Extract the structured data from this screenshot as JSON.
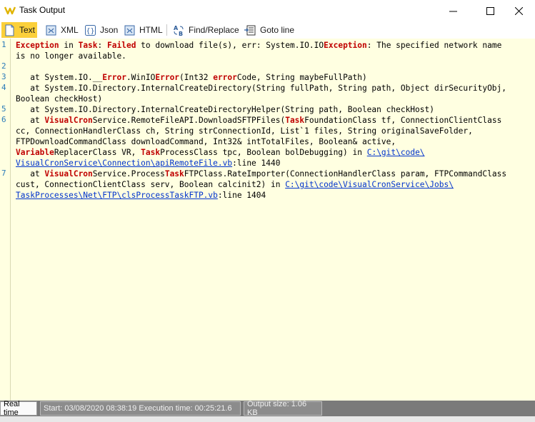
{
  "window": {
    "title": "Task Output",
    "minimize_label": "—",
    "maximize_label": "☐",
    "close_label": "✕"
  },
  "toolbar": {
    "text_label": "Text",
    "xml_label": "XML",
    "json_label": "Json",
    "html_label": "HTML",
    "find_replace_label": "Find/Replace",
    "goto_line_label": "Goto line"
  },
  "colors": {
    "editor_bg": "#ffffe1",
    "active_tab": "#fbd03a",
    "keyword": "#c00000",
    "link": "#0033cc",
    "line_number": "#2b7bb9"
  },
  "output": {
    "line_numbers": [
      "1",
      "2",
      "3",
      "4",
      "5",
      "6",
      "7"
    ],
    "l1a_kw": "Exception",
    "l1a_t1": " in ",
    "l1a_kw2": "Task",
    "l1a_t2": ": ",
    "l1a_kw3": "Failed",
    "l1a_t3": " to download file(s), err: System.IO.IO",
    "l1a_kw4": "Exception",
    "l1a_t4": ": The specified network name",
    "l1b": "is no longer available.",
    "l3_t1": "   at System.IO.__",
    "l3_kw1": "Error",
    "l3_t2": ".WinIO",
    "l3_kw2": "Error",
    "l3_t3": "(Int32 ",
    "l3_kw3": "error",
    "l3_t4": "Code, String maybeFullPath)",
    "l4a": "   at System.IO.Directory.InternalCreateDirectory(String fullPath, String path, Object dirSecurityObj,",
    "l4b": "Boolean checkHost)",
    "l5": "   at System.IO.Directory.InternalCreateDirectoryHelper(String path, Boolean checkHost)",
    "l6a_t1": "   at ",
    "l6a_kw1": "VisualCron",
    "l6a_t2": "Service.RemoteFileAPI.DownloadSFTPFiles(",
    "l6a_kw2": "Task",
    "l6a_t3": "FoundationClass tf, ConnectionClientClass",
    "l6b": "cc, ConnectionHandlerClass ch, String strConnectionId, List`1 files, String originalSaveFolder,",
    "l6c": "FTPDownloadCommandClass downloadCommand, Int32& intTotalFiles, Boolean& active,",
    "l6d_kw1": "Variable",
    "l6d_t1": "ReplacerClass VR, ",
    "l6d_kw2": "Task",
    "l6d_t2": "ProcessClass tpc, Boolean bolDebugging) in ",
    "l6d_link": "C:\\git\\code\\",
    "l6e_link": "VisualCronService\\Connection\\apiRemoteFile.vb",
    "l6e_t1": ":line 1440",
    "l7a_t1": "   at ",
    "l7a_kw1": "VisualCron",
    "l7a_t2": "Service.Process",
    "l7a_kw2": "Task",
    "l7a_t3": "FTPClass.RateImporter(ConnectionHandlerClass param, FTPCommandClass",
    "l7b_t1": "cust, ConnectionClientClass serv, Boolean calcinit2) in ",
    "l7b_link": "C:\\git\\code\\VisualCronService\\Jobs\\",
    "l7c_link": "TaskProcesses\\Net\\FTP\\clsProcessTaskFTP.vb",
    "l7c_t1": ":line 1404"
  },
  "statusbar": {
    "realtime_label": "Real time",
    "timing_text": "Start: 03/08/2020 08:38:19 Execution time: 00:25:21.6",
    "output_size_text": "Output size: 1.06 KB"
  }
}
